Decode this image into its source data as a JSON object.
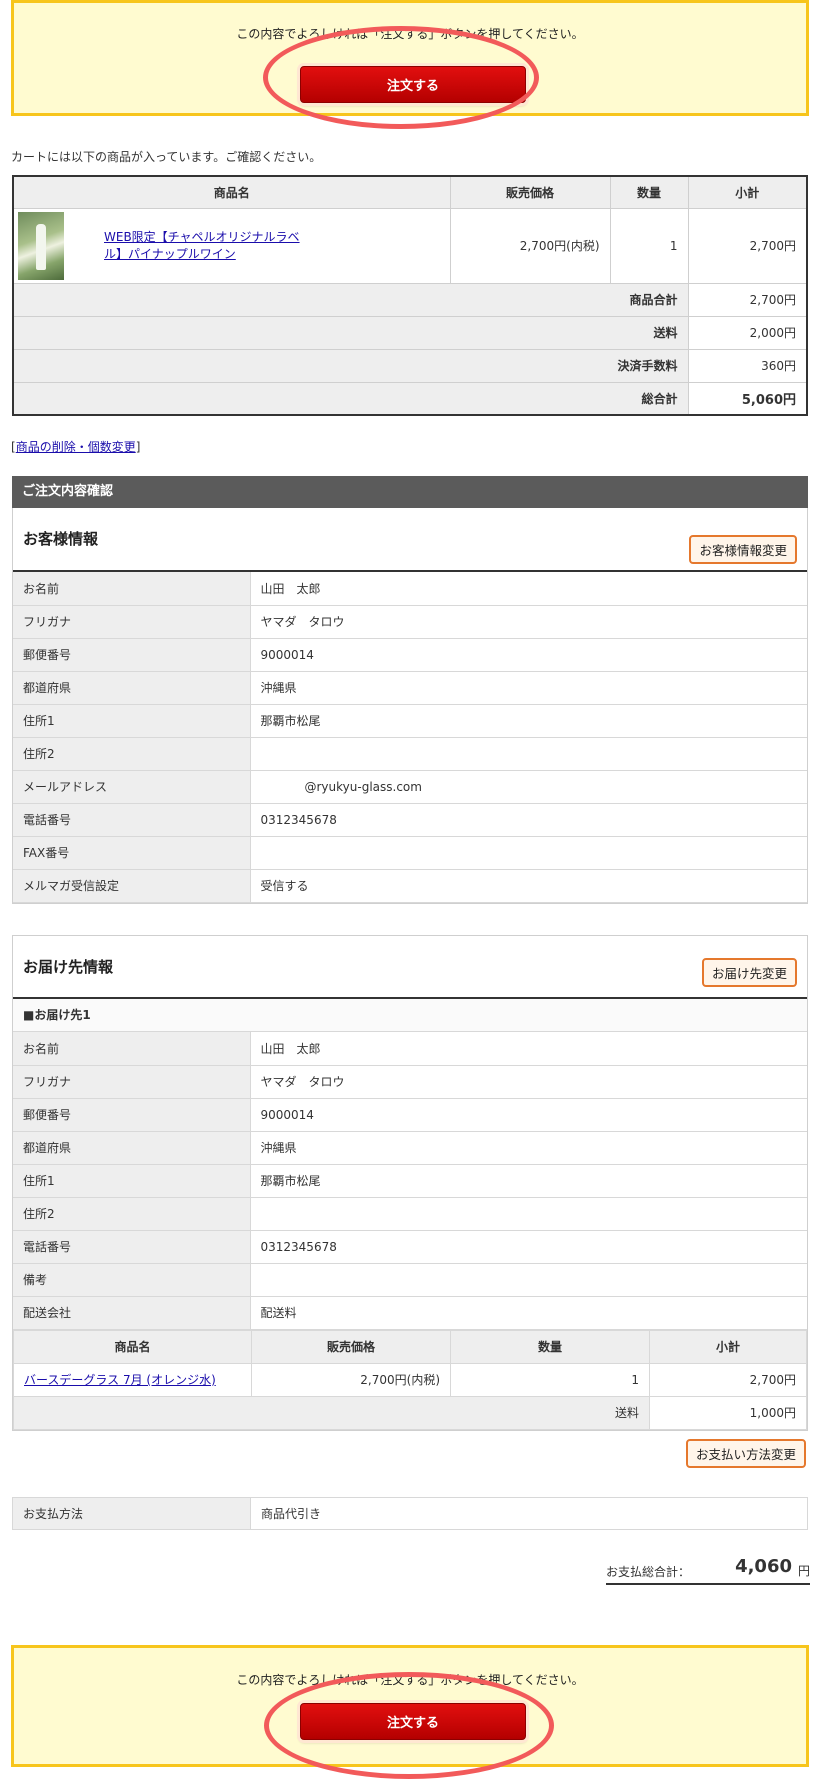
{
  "confirm": {
    "message": "この内容でよろしければ「注文する」ボタンを押してください。",
    "button_label": "注文する"
  },
  "cart_note": "カートには以下の商品が入っています。ご確認ください。",
  "cart_table": {
    "headers": [
      "商品名",
      "販売価格",
      "数量",
      "小計"
    ],
    "item": {
      "name_line1": "WEB限定【チャペルオリジナルラベ",
      "name_line2": "ル】パイナップルワイン",
      "price": "2,700円(内税)",
      "qty": "1",
      "subtotal": "2,700円"
    },
    "summary": [
      {
        "label": "商品合計",
        "value": "2,700円"
      },
      {
        "label": "送料",
        "value": "2,000円"
      },
      {
        "label": "決済手数料",
        "value": "360円"
      },
      {
        "label": "総合計",
        "value": "5,060円"
      }
    ]
  },
  "edit_link": {
    "prefix": "[",
    "label": "商品の削除・個数変更",
    "suffix": "]"
  },
  "section_title": "ご注文内容確認",
  "customer": {
    "title": "お客様情報",
    "change_button": "お客様情報変更",
    "rows": [
      {
        "k": "お名前",
        "v": "山田　太郎"
      },
      {
        "k": "フリガナ",
        "v": "ヤマダ　タロウ"
      },
      {
        "k": "郵便番号",
        "v": "9000014"
      },
      {
        "k": "都道府県",
        "v": "沖縄県"
      },
      {
        "k": "住所1",
        "v": "那覇市松尾"
      },
      {
        "k": "住所2",
        "v": ""
      },
      {
        "k": "メールアドレス",
        "v": "@ryukyu-glass.com"
      },
      {
        "k": "電話番号",
        "v": "0312345678"
      },
      {
        "k": "FAX番号",
        "v": ""
      },
      {
        "k": "メルマガ受信設定",
        "v": "受信する"
      }
    ]
  },
  "delivery": {
    "title": "お届け先情報",
    "change_button": "お届け先変更",
    "subhead": "■お届け先1",
    "rows": [
      {
        "k": "お名前",
        "v": "山田　太郎"
      },
      {
        "k": "フリガナ",
        "v": "ヤマダ　タロウ"
      },
      {
        "k": "郵便番号",
        "v": "9000014"
      },
      {
        "k": "都道府県",
        "v": "沖縄県"
      },
      {
        "k": "住所1",
        "v": "那覇市松尾"
      },
      {
        "k": "住所2",
        "v": ""
      },
      {
        "k": "電話番号",
        "v": "0312345678"
      },
      {
        "k": "備考",
        "v": ""
      },
      {
        "k": "配送会社",
        "v": "配送料"
      }
    ],
    "item_headers": [
      "商品名",
      "販売価格",
      "数量",
      "小計"
    ],
    "item": {
      "name": "バースデーグラス 7月 (オレンジ水)",
      "price": "2,700円(内税)",
      "qty": "1",
      "subtotal": "2,700円"
    },
    "shipping": {
      "label": "送料",
      "value": "1,000円"
    }
  },
  "payment_change_button": "お支払い方法変更",
  "payment": {
    "k": "お支払方法",
    "v": "商品代引き"
  },
  "grand_total": {
    "label": "お支払総合計：",
    "value": "4,060",
    "unit": "円"
  }
}
